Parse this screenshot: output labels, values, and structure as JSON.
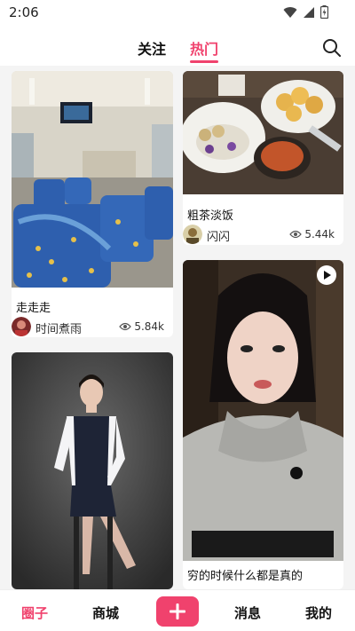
{
  "status_bar": {
    "time": "2:06"
  },
  "header": {
    "tabs": [
      {
        "label": "关注",
        "active": false
      },
      {
        "label": "热门",
        "active": true
      }
    ]
  },
  "feed": {
    "cards": [
      {
        "title": "走走走",
        "author": "时间煮雨",
        "views": "5.84k",
        "image": "train-seats-icon"
      },
      {
        "title": "粗茶淡饭",
        "author": "闪闪",
        "views": "5.44k",
        "image": "food-plate-icon"
      },
      {
        "title": "",
        "author": "",
        "views": "",
        "image": "woman-seated-photo"
      },
      {
        "title": "穷的时候什么都是真的",
        "author": "",
        "views": "",
        "image": "woman-hoodie-video",
        "video": true
      }
    ]
  },
  "bottom_nav": {
    "items": [
      {
        "label": "圈子",
        "active": true
      },
      {
        "label": "商城",
        "active": false
      },
      {
        "label": "消息",
        "active": false
      },
      {
        "label": "我的",
        "active": false
      }
    ]
  },
  "colors": {
    "accent": "#f0426d",
    "text": "#111111",
    "background": "#f4f4f4"
  }
}
